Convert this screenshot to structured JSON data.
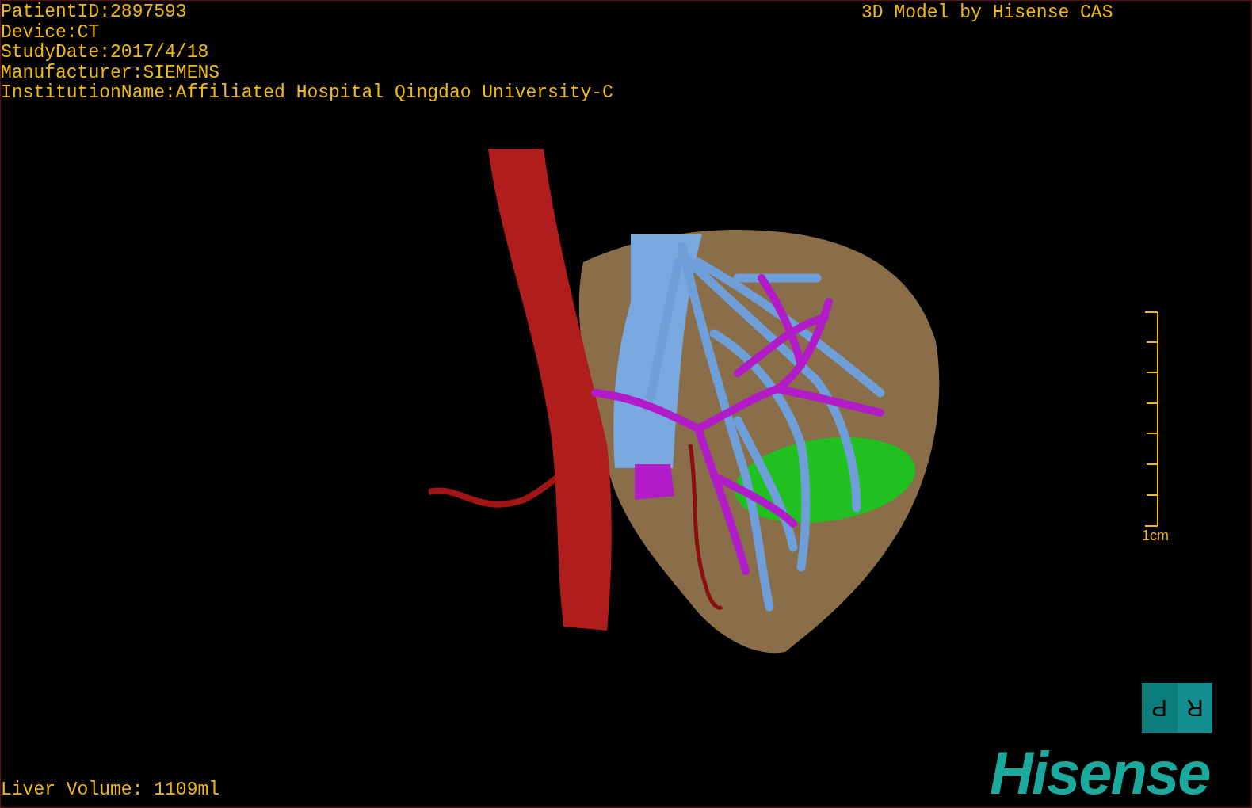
{
  "patient_info": [
    "PatientID:2897593",
    "Device:CT",
    "StudyDate:2017/4/18",
    "Manufacturer:SIEMENS",
    "InstitutionName:Affiliated Hospital Qingdao University-C"
  ],
  "model_credit": "3D Model by Hisense CAS",
  "scale_bar": {
    "label": "1cm"
  },
  "orientation_cube": {
    "faces": [
      "P",
      "R"
    ]
  },
  "logo": "Hisense",
  "liver_volume": "Liver Volume: 1109ml"
}
